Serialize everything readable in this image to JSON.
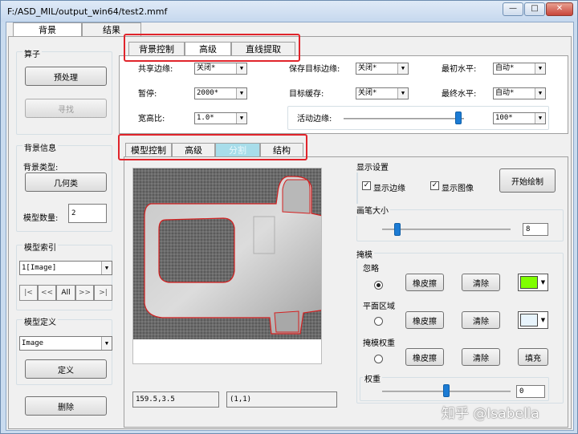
{
  "window": {
    "title": "F:/ASD_MIL/output_win64/test2.mmf",
    "controls": [
      "—",
      "□",
      "✕"
    ]
  },
  "main_tabs": [
    {
      "label": "背景"
    },
    {
      "label": "结果"
    }
  ],
  "operator": {
    "title": "算子",
    "preprocess": "预处理",
    "find": "寻找"
  },
  "bg_info": {
    "title": "背景信息",
    "type_label": "背景类型:",
    "type_value": "几何类",
    "count_label": "模型数量:",
    "count_value": "2"
  },
  "model_index": {
    "title": "模型索引",
    "value": "1[Image]",
    "nav": [
      "|<",
      "<<",
      "All",
      ">>",
      ">|"
    ]
  },
  "model_def": {
    "title": "模型定义",
    "value": "Image",
    "define": "定义"
  },
  "delete_btn": "删除",
  "top_tabs": [
    {
      "label": "背景控制"
    },
    {
      "label": "高级"
    },
    {
      "label": "直线提取"
    }
  ],
  "adv": {
    "share_edge": {
      "label": "共享边缘:",
      "value": "关闭*"
    },
    "save_edge": {
      "label": "保存目标边缘:",
      "value": "关闭*"
    },
    "first_level": {
      "label": "最初水平:",
      "value": "自动*"
    },
    "pause": {
      "label": "暂停:",
      "value": "2000*"
    },
    "target_cache": {
      "label": "目标缓存:",
      "value": "关闭*"
    },
    "final_level": {
      "label": "最终水平:",
      "value": "自动*"
    },
    "aspect": {
      "label": "宽高比:",
      "value": "1.0*"
    },
    "active_edge": {
      "label": "活动边缘:",
      "value": "100*",
      "level": 0.95
    }
  },
  "sub_tabs": [
    {
      "label": "模型控制"
    },
    {
      "label": "高级"
    },
    {
      "label": "分割"
    },
    {
      "label": "结构"
    }
  ],
  "display": {
    "title": "显示设置",
    "show_edge": "显示边缘",
    "show_image": "显示图像",
    "start_draw": "开始绘制"
  },
  "brush": {
    "title": "画笔大小",
    "value": "8",
    "level": 0.12
  },
  "mask": {
    "title": "掩模",
    "rows": [
      {
        "label": "忽略",
        "eraser": "橡皮擦",
        "clear": "清除",
        "color": "#80ff00",
        "selected": true
      },
      {
        "label": "平面区域",
        "eraser": "橡皮擦",
        "clear": "清除",
        "color": "#e8f4fc",
        "selected": false
      },
      {
        "label": "掩模权重",
        "eraser": "橡皮擦",
        "clear": "清除",
        "fill": "填充",
        "selected": false
      }
    ],
    "weight": {
      "title": "权重",
      "value": "0",
      "level": 0.5
    }
  },
  "status": {
    "coords": "159.5,3.5",
    "pixel": "(1,1)"
  },
  "watermark": "知乎 @Isabella",
  "colors": {
    "highlight": "#e0242b",
    "active_sub_tab": "#a8ddea"
  }
}
